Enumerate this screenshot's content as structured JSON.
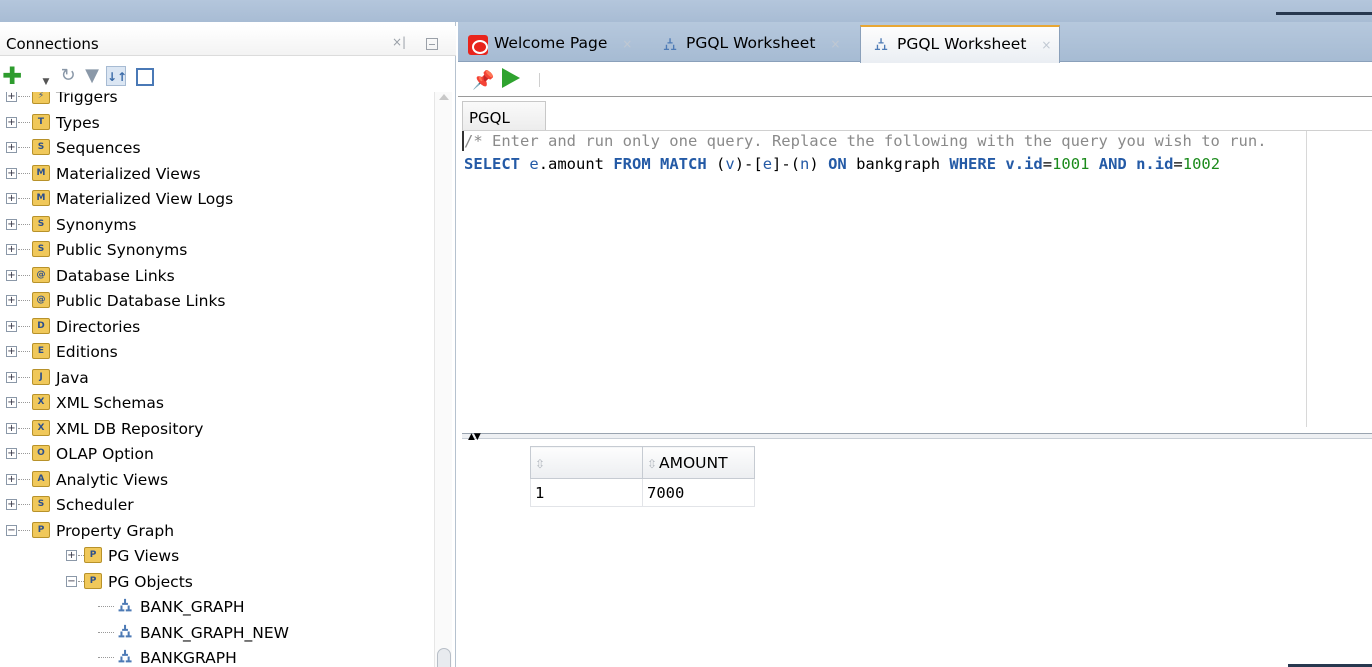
{
  "connections": {
    "title": "Connections",
    "minimize_glyph": "×|",
    "toolbar": {
      "add_icon": "plus-icon",
      "dropdown_icon": "chevron-down-icon",
      "refresh_icon": "refresh-icon",
      "filter_icon": "filter-icon",
      "sort_icon": "sort-icon",
      "columns_icon": "columns-icon"
    },
    "tree": [
      {
        "label": "Triggers",
        "level": 0,
        "expanded": false
      },
      {
        "label": "Types",
        "level": 0,
        "expanded": false
      },
      {
        "label": "Sequences",
        "level": 0,
        "expanded": false
      },
      {
        "label": "Materialized Views",
        "level": 0,
        "expanded": false
      },
      {
        "label": "Materialized View Logs",
        "level": 0,
        "expanded": false
      },
      {
        "label": "Synonyms",
        "level": 0,
        "expanded": false
      },
      {
        "label": "Public Synonyms",
        "level": 0,
        "expanded": false
      },
      {
        "label": "Database Links",
        "level": 0,
        "expanded": false
      },
      {
        "label": "Public Database Links",
        "level": 0,
        "expanded": false
      },
      {
        "label": "Directories",
        "level": 0,
        "expanded": false
      },
      {
        "label": "Editions",
        "level": 0,
        "expanded": false
      },
      {
        "label": "Java",
        "level": 0,
        "expanded": false
      },
      {
        "label": "XML Schemas",
        "level": 0,
        "expanded": false
      },
      {
        "label": "XML DB Repository",
        "level": 0,
        "expanded": false
      },
      {
        "label": "OLAP Option",
        "level": 0,
        "expanded": false
      },
      {
        "label": "Analytic Views",
        "level": 0,
        "expanded": false
      },
      {
        "label": "Scheduler",
        "level": 0,
        "expanded": false
      },
      {
        "label": "Property Graph",
        "level": 0,
        "expanded": true
      },
      {
        "label": "PG Views",
        "level": 1,
        "expanded": false
      },
      {
        "label": "PG Objects",
        "level": 1,
        "expanded": true
      },
      {
        "label": "BANK_GRAPH",
        "level": 2,
        "leaf": true
      },
      {
        "label": "BANK_GRAPH_NEW",
        "level": 2,
        "leaf": true
      },
      {
        "label": "BANKGRAPH",
        "level": 2,
        "leaf": true
      }
    ]
  },
  "tabs": [
    {
      "label": "Welcome Page",
      "icon": "oracle-icon",
      "active": false
    },
    {
      "label": "PGQL Worksheet",
      "icon": "graph-icon",
      "active": false
    },
    {
      "label": "PGQL Worksheet",
      "icon": "graph-icon",
      "active": true
    }
  ],
  "worksheet": {
    "toolbar": {
      "pin_icon": "pin-icon",
      "run_icon": "run-icon"
    },
    "editor_tab": "PGQL",
    "comment_line": "/* Enter and run only one query. Replace the following with the query you wish to run.",
    "query": {
      "select": "SELECT",
      "select_expr": "e",
      "select_field": ".amount ",
      "from": "FROM",
      "match": "MATCH",
      "pattern_1": " (",
      "v": "v",
      "pattern_2": ")-[",
      "e": "e",
      "pattern_3": "]-(",
      "n": "n",
      "pattern_4": ") ",
      "on": "ON",
      "graph": " bankgraph ",
      "where": "WHERE",
      "v_id": "v.id",
      "eq1": "=",
      "val1": "1001",
      "and": "AND",
      "n_id": "n.id",
      "eq2": "=",
      "val2": "1002"
    }
  },
  "results": {
    "columns": [
      "",
      "AMOUNT"
    ],
    "rows": [
      [
        "1",
        "7000"
      ]
    ]
  }
}
